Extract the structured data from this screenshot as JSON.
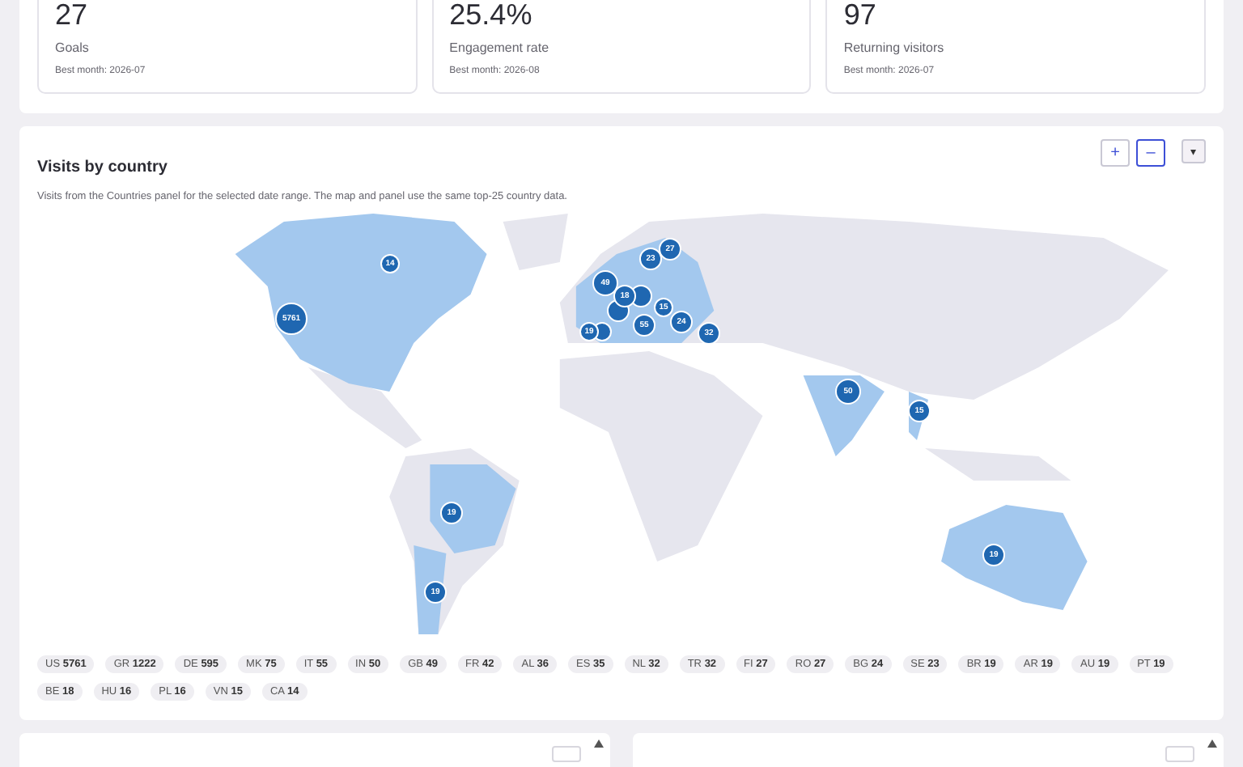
{
  "stats": [
    {
      "value": "27",
      "label": "Goals",
      "note": "Best month: 2026-07"
    },
    {
      "value": "25.4%",
      "label": "Engagement rate",
      "note": "Best month: 2026-08"
    },
    {
      "value": "97",
      "label": "Returning visitors",
      "note": "Best month: 2026-07"
    }
  ],
  "map_panel": {
    "title": "Visits by country",
    "description": "Visits from the Countries panel for the selected date range. The map and panel use the same top-25 country data.",
    "controls": [
      {
        "kind": "zoom",
        "label": "+",
        "focused": false
      },
      {
        "kind": "zoom",
        "label": "–",
        "focused": true
      },
      {
        "kind": "menu",
        "label": "▾",
        "focused": false
      }
    ],
    "markers": [
      {
        "label": "5761"
      },
      {
        "label": "14"
      },
      {
        "label": "23"
      },
      {
        "label": "27"
      },
      {
        "label": "49"
      },
      {
        "label": "18"
      },
      {
        "label": "15"
      },
      {
        "label": "55"
      },
      {
        "label": "24"
      },
      {
        "label": "32"
      },
      {
        "label": "19"
      },
      {
        "label": "50"
      },
      {
        "label": "15"
      },
      {
        "label": "19"
      },
      {
        "label": "19"
      },
      {
        "label": "19"
      }
    ],
    "chips": [
      "US **5761**",
      "GR **1222**",
      "DE **595**",
      "MK **75**",
      "IT **55**",
      "IN **50**",
      "GB **49**",
      "FR **42**",
      "AL **36**",
      "ES **35**",
      "NL **32**",
      "TR **32**",
      "FI **27**",
      "RO **27**",
      "BG **24**",
      "SE **23**",
      "BR **19**",
      "AR **19**",
      "AU **19**",
      "PT **19**",
      "BE **18**",
      "HU **16**",
      "PL **16**",
      "VN **15**",
      "CA **14**"
    ]
  }
}
